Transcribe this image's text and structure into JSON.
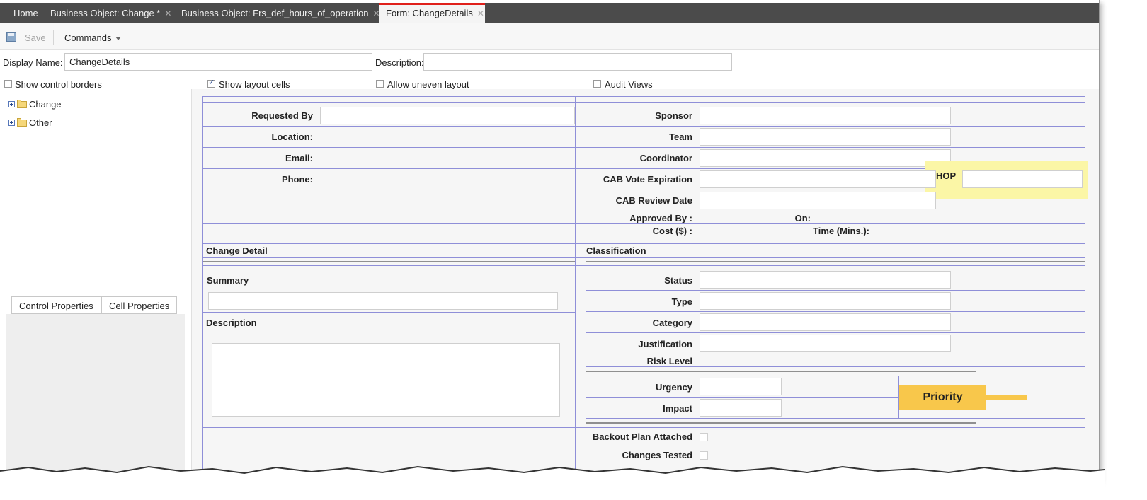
{
  "tabs": [
    {
      "label": "Home",
      "closable": false
    },
    {
      "label": "Business Object: Change *",
      "closable": true
    },
    {
      "label": "Business Object: Frs_def_hours_of_operation",
      "closable": true
    },
    {
      "label": "Form: ChangeDetails",
      "closable": true,
      "active": true
    }
  ],
  "close_glyph": "✕",
  "toolbar": {
    "save_label": "Save",
    "commands_label": "Commands"
  },
  "form_header": {
    "display_name_label": "Display Name:",
    "display_name_value": "ChangeDetails",
    "description_label": "Description:",
    "description_value": ""
  },
  "options": [
    {
      "label": "Show control borders",
      "checked": false
    },
    {
      "label": "Show layout cells",
      "checked": true
    },
    {
      "label": "Allow uneven layout",
      "checked": false
    },
    {
      "label": "Audit Views",
      "checked": false
    }
  ],
  "tree": [
    {
      "label": "Change"
    },
    {
      "label": "Other"
    }
  ],
  "property_tabs": [
    "Control Properties",
    "Cell Properties"
  ],
  "form": {
    "left_fields": {
      "requested_by": "Requested By",
      "location": "Location:",
      "email": "Email:",
      "phone": "Phone:"
    },
    "right_fields": {
      "sponsor": "Sponsor",
      "team": "Team",
      "coordinator": "Coordinator",
      "cab_vote_expiration": "CAB Vote Expiration",
      "cab_review_date": "CAB Review Date",
      "approved_by": "Approved By :",
      "on": "On:",
      "cost": "Cost ($) :",
      "time": "Time (Mins.):"
    },
    "hop_label": "HOP",
    "change_detail": "Change Detail",
    "classification": "Classification",
    "summary": "Summary",
    "description": "Description",
    "status": "Status",
    "type": "Type",
    "category": "Category",
    "justification": "Justification",
    "risk_level": "Risk Level",
    "urgency": "Urgency",
    "impact": "Impact",
    "priority_callout": "Priority",
    "backout_plan": "Backout Plan Attached",
    "changes_tested": "Changes Tested"
  },
  "colors": {
    "tab_bar": "#4b4b4b",
    "active_tab_accent": "#e0201b",
    "layout_lines": "#8f8fd8",
    "hop_highlight": "#fbf6a6",
    "priority_callout": "#f8c74b"
  }
}
